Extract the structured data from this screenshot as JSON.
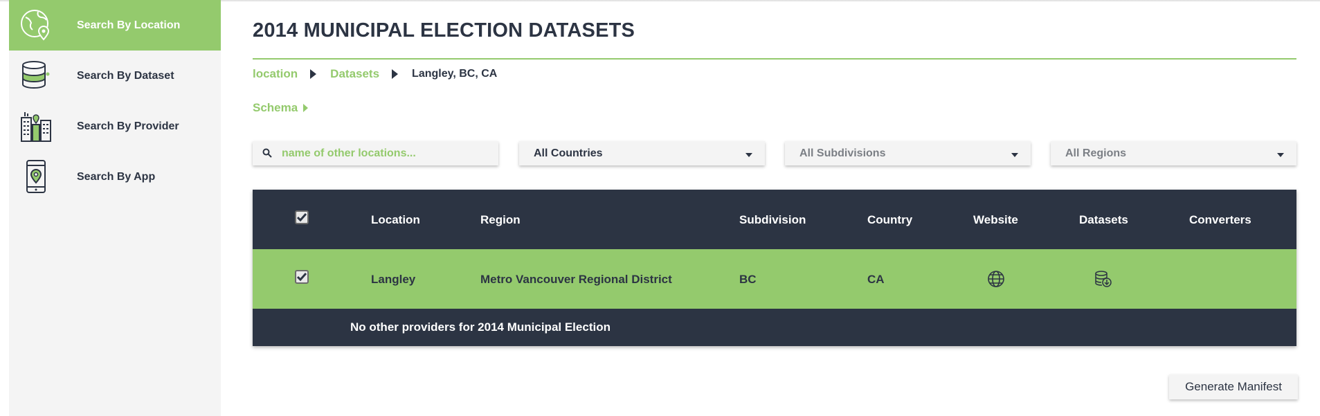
{
  "sidebar": {
    "items": [
      {
        "label": "Search By Location",
        "icon": "globe-location-icon",
        "active": true
      },
      {
        "label": "Search By Dataset",
        "icon": "database-icon",
        "active": false
      },
      {
        "label": "Search By Provider",
        "icon": "buildings-icon",
        "active": false
      },
      {
        "label": "Search By App",
        "icon": "phone-location-icon",
        "active": false
      }
    ]
  },
  "page": {
    "title": "2014 MUNICIPAL ELECTION DATASETS"
  },
  "breadcrumb": {
    "items": [
      "location",
      "Datasets",
      "Langley, BC, CA"
    ]
  },
  "schema_label": "Schema",
  "filters": {
    "search_placeholder": "name of other locations...",
    "country": "All Countries",
    "subdivision": "All Subdivisions",
    "region": "All Regions"
  },
  "table": {
    "headers": [
      "Location",
      "Region",
      "Subdivision",
      "Country",
      "Website",
      "Datasets",
      "Converters"
    ],
    "rows": [
      {
        "checked": true,
        "location": "Langley",
        "region": "Metro Vancouver Regional District",
        "subdivision": "BC",
        "country": "CA",
        "website_icon": "globe-icon",
        "datasets_icon": "database-download-icon"
      }
    ],
    "footer_note": "No other providers for 2014 Municipal Election"
  },
  "actions": {
    "generate_label": "Generate Manifest"
  },
  "colors": {
    "accent": "#94ca6d",
    "dark": "#2c3443",
    "panel": "#f4f4f4"
  }
}
